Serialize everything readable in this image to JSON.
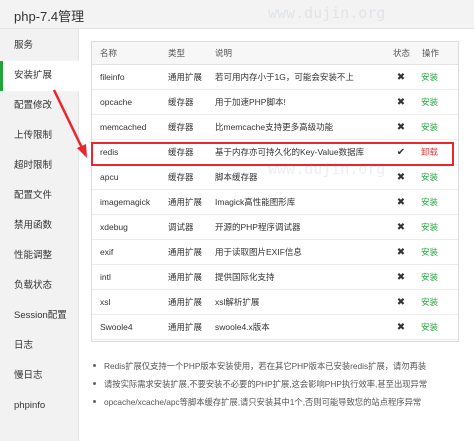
{
  "title": "php-7.4管理",
  "sidebar": {
    "items": [
      {
        "label": "服务"
      },
      {
        "label": "安装扩展"
      },
      {
        "label": "配置修改"
      },
      {
        "label": "上传限制"
      },
      {
        "label": "超时限制"
      },
      {
        "label": "配置文件"
      },
      {
        "label": "禁用函数"
      },
      {
        "label": "性能调整"
      },
      {
        "label": "负载状态"
      },
      {
        "label": "Session配置"
      },
      {
        "label": "日志"
      },
      {
        "label": "慢日志"
      },
      {
        "label": "phpinfo"
      }
    ]
  },
  "table": {
    "headers": {
      "name": "名称",
      "type": "类型",
      "desc": "说明",
      "status": "状态",
      "op": "操作"
    },
    "rows": [
      {
        "name": "fileinfo",
        "type": "通用扩展",
        "desc": "若可用内存小于1G，可能会安装不上",
        "status": "✖",
        "op": "安装"
      },
      {
        "name": "opcache",
        "type": "缓存器",
        "desc": "用于加速PHP脚本!",
        "status": "✖",
        "op": "安装"
      },
      {
        "name": "memcached",
        "type": "缓存器",
        "desc": "比memcache支持更多高级功能",
        "status": "✖",
        "op": "安装"
      },
      {
        "name": "redis",
        "type": "缓存器",
        "desc": "基于内存亦可持久化的Key-Value数据库",
        "status": "✔",
        "op": "卸载"
      },
      {
        "name": "apcu",
        "type": "缓存器",
        "desc": "脚本缓存器",
        "status": "✖",
        "op": "安装"
      },
      {
        "name": "imagemagick",
        "type": "通用扩展",
        "desc": "Imagick高性能图形库",
        "status": "✖",
        "op": "安装"
      },
      {
        "name": "xdebug",
        "type": "调试器",
        "desc": "开源的PHP程序调试器",
        "status": "✖",
        "op": "安装"
      },
      {
        "name": "exif",
        "type": "通用扩展",
        "desc": "用于读取图片EXIF信息",
        "status": "✖",
        "op": "安装"
      },
      {
        "name": "intl",
        "type": "通用扩展",
        "desc": "提供国际化支持",
        "status": "✖",
        "op": "安装"
      },
      {
        "name": "xsl",
        "type": "通用扩展",
        "desc": "xsl解析扩展",
        "status": "✖",
        "op": "安装"
      },
      {
        "name": "Swoole4",
        "type": "通用扩展",
        "desc": "swoole4.x版本",
        "status": "✖",
        "op": "安装"
      }
    ]
  },
  "notes": [
    "Redis扩展仅支持一个PHP版本安装使用，若在其它PHP版本已安装redis扩展，请勿再装",
    "请按实际需求安装扩展,不要安装不必要的PHP扩展,这会影响PHP执行效率,甚至出现异常",
    "opcache/xcache/apc等脚本缓存扩展,请只安装其中1个,否则可能导致您的站点程序异常"
  ],
  "watermark": "www.dujin.org",
  "colors": {
    "accent": "#20a53a",
    "danger": "#e43c3c",
    "highlight": "#e8262b"
  }
}
